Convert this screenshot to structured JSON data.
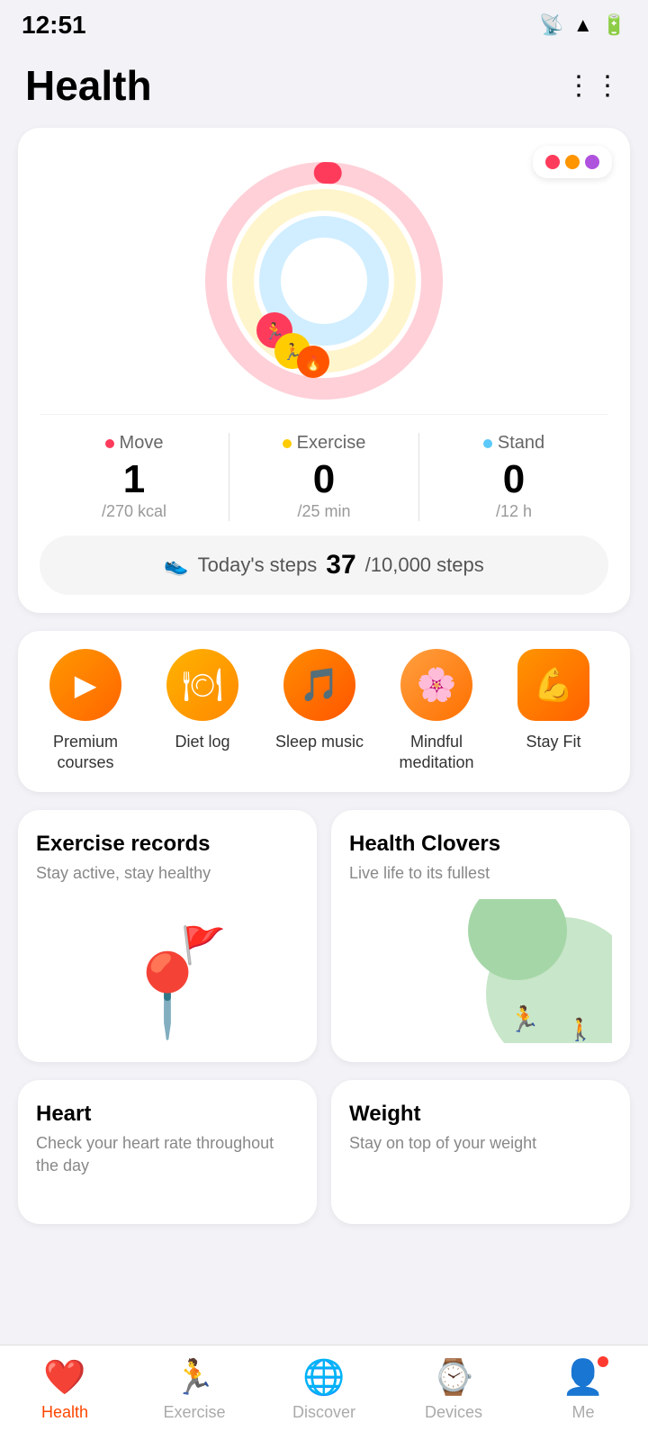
{
  "statusBar": {
    "time": "12:51",
    "icons": [
      "cast",
      "wifi",
      "battery"
    ]
  },
  "header": {
    "title": "Health",
    "moreLabel": "⠿"
  },
  "activityCard": {
    "dotsLabel": "activity-rings-legend",
    "ring": {
      "move": {
        "label": "Move",
        "value": "1",
        "sub": "/270 kcal",
        "color": "#ff3b5c",
        "percent": 2
      },
      "exercise": {
        "label": "Exercise",
        "value": "0",
        "sub": "/25 min",
        "color": "#ffcc00",
        "percent": 0
      },
      "stand": {
        "label": "Stand",
        "value": "0",
        "sub": "/12 h",
        "color": "#5ac8fa",
        "percent": 0
      }
    },
    "steps": {
      "label": "Today's steps",
      "count": "37",
      "total": "/10,000 steps"
    }
  },
  "quickAccess": {
    "items": [
      {
        "id": "premium-courses",
        "label": "Premium courses",
        "icon": "▶"
      },
      {
        "id": "diet-log",
        "label": "Diet log",
        "icon": "🍱"
      },
      {
        "id": "sleep-music",
        "label": "Sleep music",
        "icon": "🎵"
      },
      {
        "id": "mindful-meditation",
        "label": "Mindful meditation",
        "icon": "🌸"
      },
      {
        "id": "stay-fit",
        "label": "Stay Fit",
        "icon": "💪"
      }
    ]
  },
  "featureCards": [
    {
      "id": "exercise-records",
      "title": "Exercise records",
      "subtitle": "Stay active, stay healthy"
    },
    {
      "id": "health-clovers",
      "title": "Health Clovers",
      "subtitle": "Live life to its fullest"
    }
  ],
  "bottomCards": [
    {
      "id": "heart",
      "title": "Heart",
      "subtitle": "Check your heart rate throughout the day"
    },
    {
      "id": "weight",
      "title": "Weight",
      "subtitle": "Stay on top of your weight"
    }
  ],
  "bottomNav": {
    "items": [
      {
        "id": "health",
        "label": "Health",
        "icon": "❤",
        "active": true
      },
      {
        "id": "exercise",
        "label": "Exercise",
        "icon": "🏃",
        "active": false
      },
      {
        "id": "discover",
        "label": "Discover",
        "icon": "🌐",
        "active": false
      },
      {
        "id": "devices",
        "label": "Devices",
        "icon": "⌚",
        "active": false
      },
      {
        "id": "me",
        "label": "Me",
        "icon": "👤",
        "active": false,
        "badge": true
      }
    ]
  }
}
